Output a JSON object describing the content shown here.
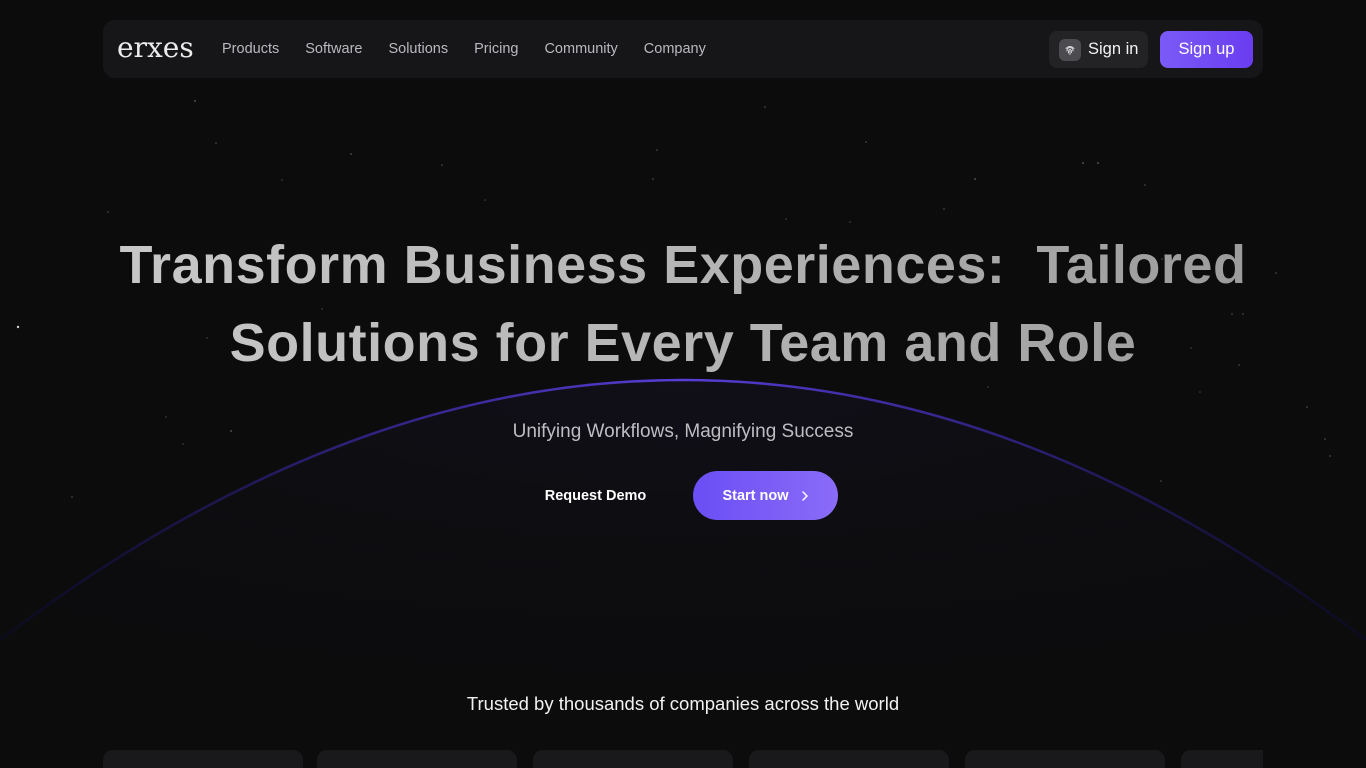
{
  "brand": {
    "logo_text": "erxes"
  },
  "nav": {
    "items": [
      {
        "label": "Products"
      },
      {
        "label": "Software"
      },
      {
        "label": "Solutions"
      },
      {
        "label": "Pricing"
      },
      {
        "label": "Community"
      },
      {
        "label": "Company"
      }
    ],
    "signin_label": "Sign in",
    "signin_icon": "fingerprint-icon",
    "signup_label": "Sign up"
  },
  "hero": {
    "title_line1": "Transform Business Experiences:  Tailored",
    "title_line2": "Solutions for Every Team and Role",
    "subtitle": "Unifying Workflows, Magnifying Success",
    "request_demo_label": "Request Demo",
    "start_now_label": "Start now",
    "start_now_icon": "chevron-right-icon"
  },
  "trusted": {
    "heading": "Trusted by thousands of companies across the world"
  },
  "colors": {
    "background": "#0c0c0d",
    "navbar": "#161618",
    "accent": "#7a5af8",
    "arc": "#5a3ed8"
  }
}
